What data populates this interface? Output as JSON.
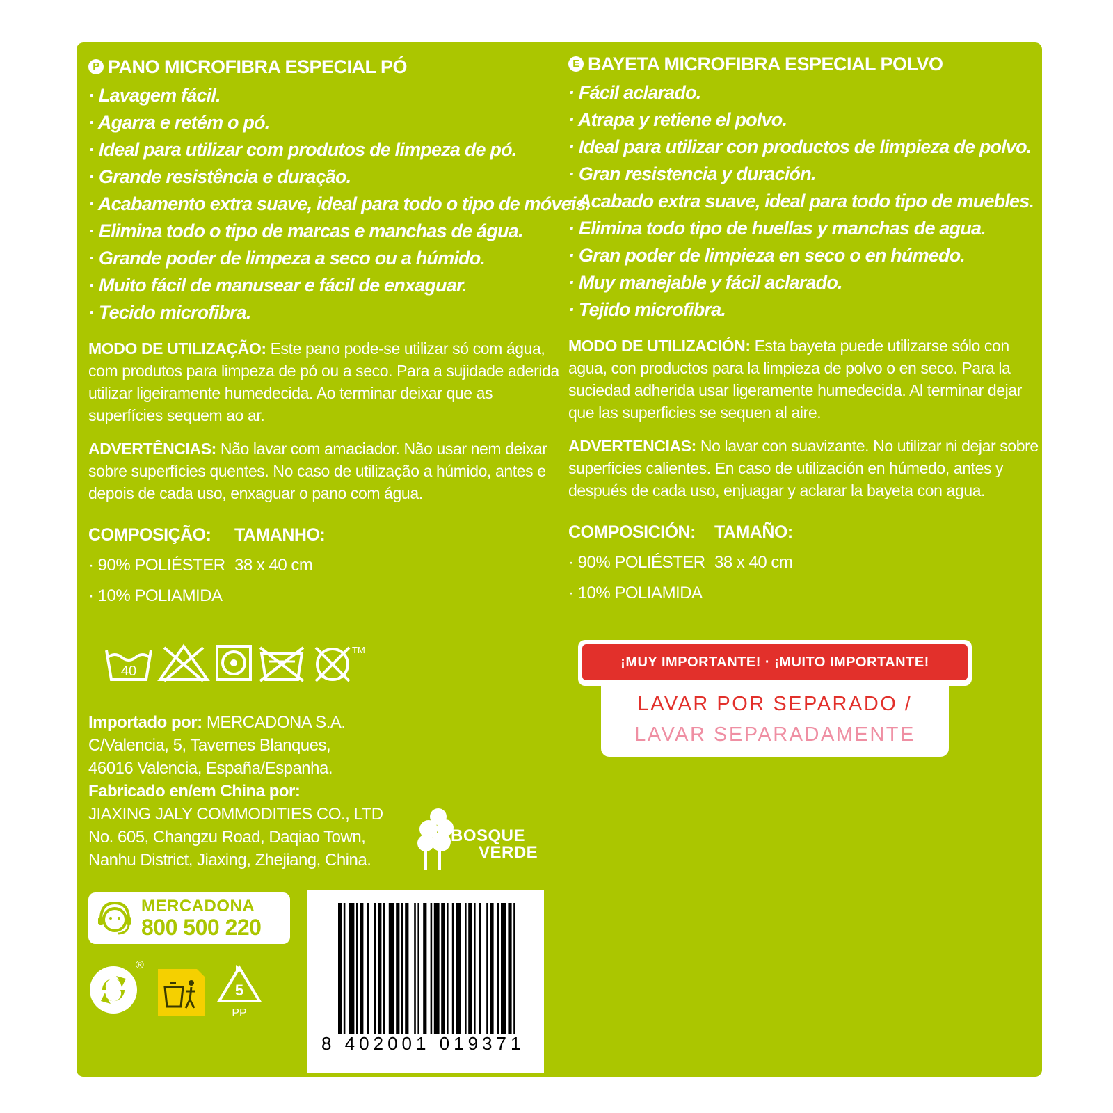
{
  "colors": {
    "panel": "#abc600",
    "text": "#ffffff",
    "warning_red": "#e2302b",
    "warning_pink": "#ef8fa3"
  },
  "pt": {
    "badge": "P",
    "title": "PANO MICROFIBRA ESPECIAL PÓ",
    "features": [
      "· Lavagem fácil.",
      "· Agarra e retém o pó.",
      "· Ideal para utilizar com produtos de limpeza de pó.",
      "· Grande resistência e duração.",
      "· Acabamento extra suave, ideal para todo o tipo de móveis.",
      "· Elimina todo o tipo de marcas e manchas de água.",
      "· Grande poder de limpeza a seco ou a húmido.",
      "· Muito fácil de manusear e fácil de enxaguar.",
      "· Tecido microfibra."
    ],
    "usage_label": "MODO DE UTILIZAÇÃO:",
    "usage_text": " Este pano pode-se utilizar só com água, com produtos para limpeza de pó ou a seco. Para a sujidade aderida utilizar ligeiramente humedecida. Ao terminar deixar que as superfícies sequem ao ar.",
    "warn_label": "ADVERTÊNCIAS:",
    "warn_text": " Não lavar com amaciador. Não usar nem deixar sobre superfícies quentes. No caso de utilização a húmido, antes e depois de cada uso, enxaguar o pano com água.",
    "composition_label": "COMPOSIÇÃO:",
    "size_label": "TAMANHO:",
    "composition_1": "· 90% POLIÉSTER",
    "composition_2": "· 10% POLIAMIDA",
    "size_value": "38 x 40 cm"
  },
  "es": {
    "badge": "E",
    "title": "BAYETA MICROFIBRA ESPECIAL POLVO",
    "features": [
      "· Fácil aclarado.",
      "· Atrapa y retiene el polvo.",
      "· Ideal para utilizar con productos de limpieza de polvo.",
      "· Gran resistencia y duración.",
      "· Acabado extra suave, ideal para todo tipo de muebles.",
      "· Elimina todo tipo de huellas y manchas de agua.",
      "· Gran poder de limpieza en seco o en húmedo.",
      "· Muy manejable y fácil aclarado.",
      "· Tejido microfibra."
    ],
    "usage_label": "MODO DE UTILIZACIÓN:",
    "usage_text": " Esta bayeta puede utilizarse sólo con agua, con productos para la limpieza de polvo o en seco. Para la suciedad adherida usar ligeramente humedecida. Al terminar dejar que las superficies se sequen al aire.",
    "warn_label": "ADVERTENCIAS:",
    "warn_text": " No lavar con suavizante. No utilizar ni dejar sobre superficies calientes. En caso de utilización en húmedo, antes y después de cada uso, enjuagar y aclarar la bayeta con agua.",
    "composition_label": "COMPOSICIÓN:",
    "size_label": "TAMAÑO:",
    "composition_1": "· 90% POLIÉSTER",
    "composition_2": "· 10% POLIAMIDA",
    "size_value": "38 x 40 cm"
  },
  "care": {
    "wash_temp": "40",
    "trademark": "TM",
    "icons": [
      "wash-40-icon",
      "no-bleach-icon",
      "tumble-dry-icon",
      "no-dry-clean-icon",
      "no-iron-icon"
    ]
  },
  "importer": {
    "imported_label": "Importado por:",
    "imported_value": " MERCADONA S.A.",
    "address_1": "C/Valencia, 5, Tavernes Blanques,",
    "address_2": "46016 Valencia, España/Espanha.",
    "made_label": "Fabricado en/em China por:",
    "maker_1": "JIAXING JALY COMMODITIES CO., LTD",
    "maker_2": "No. 605, Changzu Road, Daqiao Town,",
    "maker_3": "Nanhu District, Jiaxing, Zhejiang, China."
  },
  "bosque": {
    "line1": "BOSQUE",
    "line2": "VERDE"
  },
  "mercadona": {
    "name": "MERCADONA",
    "phone": "800 500 220"
  },
  "recycling": {
    "registered": "®",
    "plastic_code": "5",
    "plastic_type": "PP"
  },
  "barcode": {
    "number": "8 402001 019371"
  },
  "warning": {
    "top": "¡MUY IMPORTANTE! · ¡MUITO IMPORTANTE!",
    "line1": "LAVAR POR SEPARADO /",
    "line2": "LAVAR SEPARADAMENTE"
  }
}
